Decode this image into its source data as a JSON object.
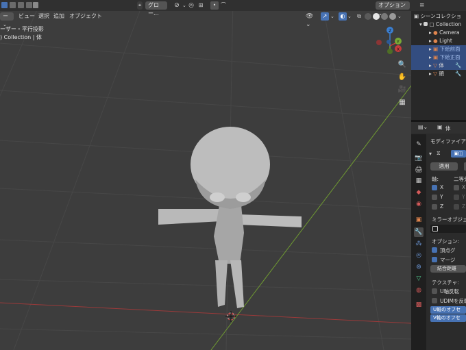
{
  "header": {
    "mode_partial": "ー",
    "transform_orientation": "グロー...",
    "options_label": "オプション"
  },
  "viewport_menu": {
    "items": [
      "ビュー",
      "選択",
      "追加",
      "オブジェクト"
    ],
    "mode_partial": "ー"
  },
  "viewport_overlay": {
    "view_name": "ーザー・平行投影",
    "collection_info": ") Collection | 体"
  },
  "gizmo": {
    "z_label": "Z",
    "y_label": "Y",
    "x_label": "X"
  },
  "outliner": {
    "title": "シーンコレクショ",
    "rows": [
      {
        "label": "Collection",
        "selected": false
      },
      {
        "label": "Camera",
        "selected": false
      },
      {
        "label": "Light",
        "selected": false
      },
      {
        "label": "下絵前面",
        "selected": true
      },
      {
        "label": "下絵正面",
        "selected": true
      },
      {
        "label": "体",
        "selected": true
      },
      {
        "label": "頭",
        "selected": false
      }
    ]
  },
  "properties": {
    "object_name": "体",
    "modifier_panel": "モディファイア",
    "apply_label": "適用",
    "axis_label": "軸:",
    "bisect_label": "二等分",
    "axes": [
      {
        "label": "X",
        "checked": true
      },
      {
        "label": "Y",
        "checked": false
      },
      {
        "label": "Z",
        "checked": false
      }
    ],
    "bisect_axes": [
      {
        "label": "X",
        "checked": false
      },
      {
        "label": "Y",
        "checked": false
      },
      {
        "label": "Z",
        "checked": false
      }
    ],
    "mirror_object_label": "ミラーオブジェ",
    "options_label": "オプション:",
    "vertex_group_label": "頂点グ",
    "merge_label": "マージ",
    "merge_distance_label": "結合距離",
    "texture_label": "テクスチャ:",
    "u_flip_label": "U軸反転",
    "udim_label": "UDIMを反転",
    "u_offset_label": "U軸のオフセ",
    "v_offset_label": "V軸のオフセ"
  },
  "colors": {
    "accent": "#4772b3",
    "x_axis": "#c83c3c",
    "y_axis": "#78a835",
    "z_axis": "#3b7fd1"
  }
}
